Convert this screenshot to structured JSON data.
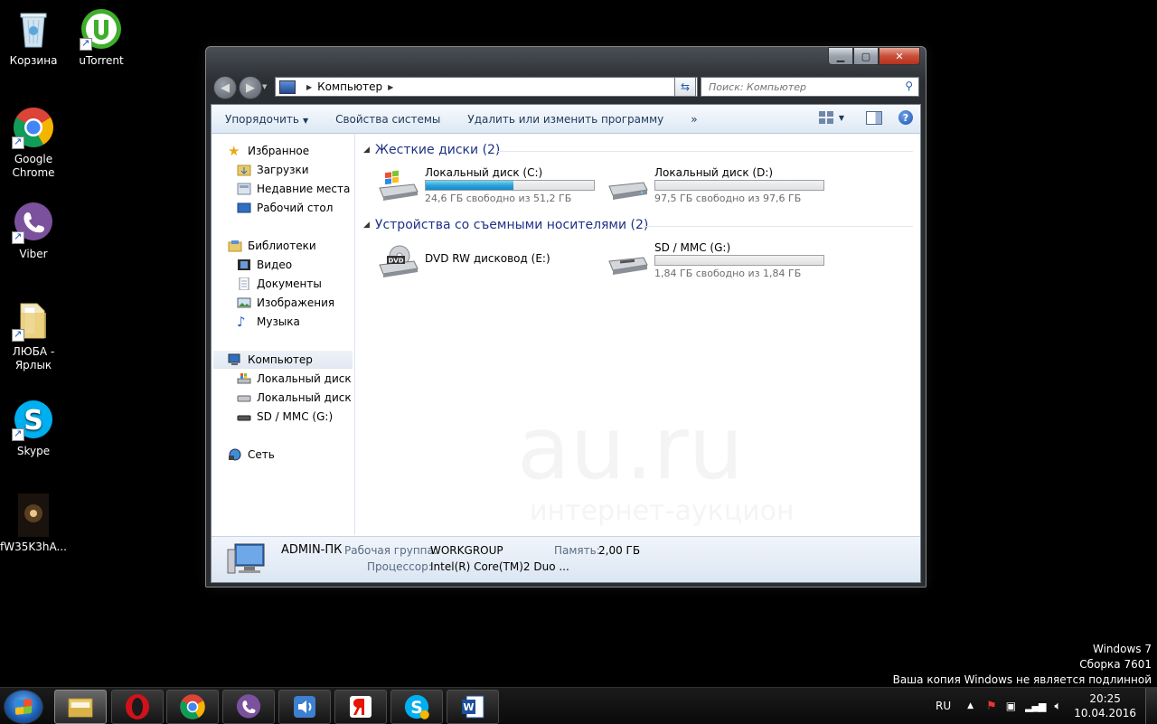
{
  "desktop": {
    "icons": [
      {
        "label": "Корзина",
        "icon": "recycle-bin-icon"
      },
      {
        "label": "uTorrent",
        "icon": "utorrent-icon"
      },
      {
        "label": "Google Chrome",
        "icon": "chrome-icon"
      },
      {
        "label": "Viber",
        "icon": "viber-icon"
      },
      {
        "label": "ЛЮБА - Ярлык",
        "icon": "folder-icon"
      },
      {
        "label": "Skype",
        "icon": "skype-icon"
      },
      {
        "label": "fW35K3hA...",
        "icon": "image-thumbnail-icon"
      }
    ]
  },
  "window": {
    "address": {
      "crumb": "Компьютер"
    },
    "search": {
      "placeholder": "Поиск: Компьютер"
    },
    "toolbar": {
      "organize": "Упорядочить",
      "system_properties": "Свойства системы",
      "uninstall": "Удалить или изменить программу",
      "more": "»"
    },
    "nav": {
      "favorites": "Избранное",
      "downloads": "Загрузки",
      "recent": "Недавние места",
      "desktop": "Рабочий стол",
      "libraries": "Библиотеки",
      "video": "Видео",
      "documents": "Документы",
      "pictures": "Изображения",
      "music": "Музыка",
      "computer": "Компьютер",
      "drive_c": "Локальный диск (C",
      "drive_d": "Локальный диск (D",
      "drive_g": "SD / MMC (G:)",
      "network": "Сеть"
    },
    "groups": {
      "hard_disks": "Жесткие диски (2)",
      "removable": "Устройства со съемными носителями (2)"
    },
    "drives": {
      "c": {
        "name": "Локальный диск (C:)",
        "free": "24,6 ГБ свободно из 51,2 ГБ",
        "used_fraction": 0.52
      },
      "d": {
        "name": "Локальный диск (D:)",
        "free": "97,5 ГБ свободно из 97,6 ГБ",
        "used_fraction": 0.001
      },
      "e": {
        "name": "DVD RW дисковод (E:)"
      },
      "g": {
        "name": "SD / MMC (G:)",
        "free": "1,84 ГБ свободно из 1,84 ГБ",
        "used_fraction": 0.0
      }
    },
    "details": {
      "computer_name": "ADMIN-ПК",
      "workgroup_label": "Рабочая группа:",
      "workgroup_value": "WORKGROUP",
      "memory_label": "Память:",
      "memory_value": "2,00 ГБ",
      "cpu_label": "Процессор:",
      "cpu_value": "Intel(R) Core(TM)2 Duo ..."
    },
    "watermark": {
      "line1": "au.ru",
      "line2": "интернет-аукцион"
    }
  },
  "activation": {
    "line1": "Windows 7",
    "line2": "Сборка 7601",
    "line3": "Ваша копия Windows не является подлинной"
  },
  "taskbar": {
    "language": "RU",
    "time": "20:25",
    "date": "10.04.2016",
    "dvd_label": "DVD",
    "buttons": [
      "explorer",
      "opera",
      "chrome",
      "viber",
      "audio",
      "yandex",
      "skype",
      "word"
    ]
  },
  "colors": {
    "group_header": "#1e3287",
    "progress_fill": "#2aa4db",
    "desktop_bg": "#000000"
  }
}
